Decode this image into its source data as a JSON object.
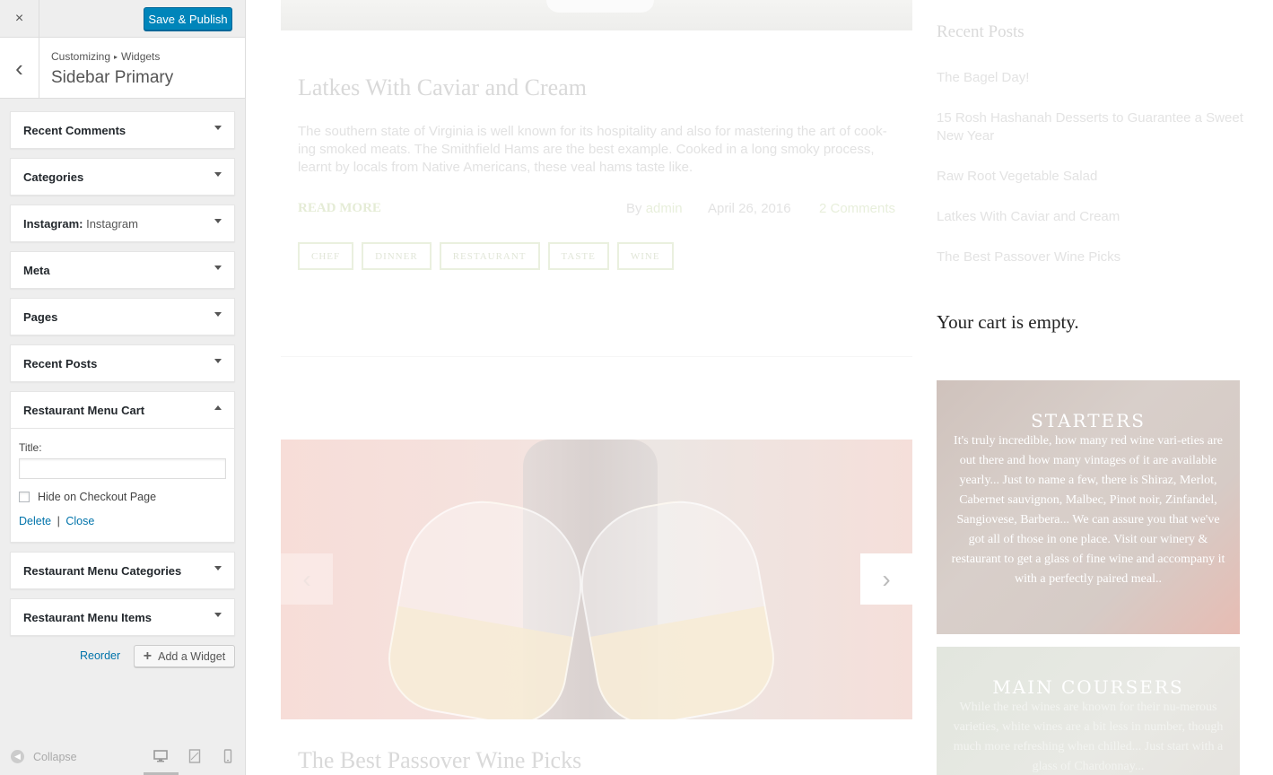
{
  "customizer": {
    "close_glyph": "×",
    "publish_label": "Save & Publish",
    "back_glyph": "‹",
    "breadcrumb": {
      "root": "Customizing",
      "separator": "▸",
      "current": "Widgets"
    },
    "section_title": "Sidebar Primary",
    "widgets": [
      {
        "title": "Recent Comments",
        "instance": ""
      },
      {
        "title": "Categories",
        "instance": ""
      },
      {
        "title": "Instagram:",
        "instance": "Instagram"
      },
      {
        "title": "Meta",
        "instance": ""
      },
      {
        "title": "Pages",
        "instance": ""
      },
      {
        "title": "Recent Posts",
        "instance": ""
      },
      {
        "title": "Restaurant Menu Cart",
        "instance": "",
        "expanded": true
      },
      {
        "title": "Restaurant Menu Categories",
        "instance": ""
      },
      {
        "title": "Restaurant Menu Items",
        "instance": ""
      }
    ],
    "expanded_widget": {
      "title_label": "Title:",
      "title_value": "",
      "checkbox_label": "Hide on Checkout Page",
      "checkbox_checked": false,
      "delete_label": "Delete",
      "link_separator": "|",
      "close_label": "Close"
    },
    "reorder_label": "Reorder",
    "add_widget_label": "Add a Widget",
    "collapse_label": "Collapse",
    "device_icons": [
      "desktop-icon",
      "tablet-icon",
      "mobile-icon"
    ],
    "accent_color": "#0085ba"
  },
  "preview": {
    "post1": {
      "title": "Latkes With Caviar and Cream",
      "excerpt": "The southern state of Virginia is well known for its hospitality and also for mastering the art of cook-ing smoked meats. The Smithfield Hams are the best example. Cooked in a long smoky process, learnt by locals from Native Americans, these veal hams taste like.",
      "read_more": "READ MORE",
      "by": "By",
      "author": "admin",
      "date": "April 26, 2016",
      "comments": "2 Comments",
      "tags": [
        "CHEF",
        "DINNER",
        "RESTAURANT",
        "TASTE",
        "WINE"
      ]
    },
    "slider": {
      "prev_glyph": "‹",
      "next_glyph": "›"
    },
    "post2": {
      "title": "The Best Passover Wine Picks"
    },
    "sidebar": {
      "recent_posts_heading": "Recent Posts",
      "recent_posts": [
        "The Bagel Day!",
        "15 Rosh Hashanah Desserts to Guarantee a Sweet New Year",
        "Raw Root Vegetable Salad",
        "Latkes With Caviar and Cream",
        "The Best Passover Wine Picks"
      ],
      "cart_text": "Your cart is empty.",
      "starters": {
        "title": "STARTERS",
        "text": "It's truly incredible, how many red wine vari-eties are out there and how many vintages of it are available yearly... Just to name a few, there is Shiraz, Merlot, Cabernet sauvignon, Malbec, Pinot noir, Zinfandel, Sangiovese, Barbera... We can assure you that we've got all of those in one place. Visit our winery & restaurant to get a glass of fine wine and accompany it with a perfectly paired meal.."
      },
      "main_courses": {
        "title": "MAIN COURSERS",
        "text": "While the red wines are known for their nu-merous varieties, white wines are a bit less in number, though much more refreshing when chilled... Just start with a glass of Chardonnay..."
      }
    }
  }
}
